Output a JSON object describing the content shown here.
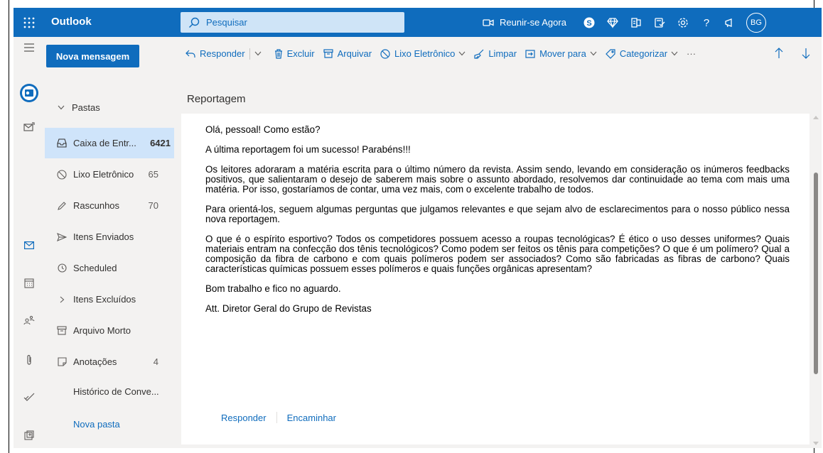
{
  "topbar": {
    "app_name": "Outlook",
    "search_placeholder": "Pesquisar",
    "meet_now": "Reunir-se Agora",
    "avatar_initials": "BG",
    "icons": [
      "waffle-icon",
      "search-icon",
      "video-icon",
      "skype-icon",
      "diamond-icon",
      "office-icon",
      "tasks-icon",
      "settings-icon",
      "help-icon",
      "megaphone-icon"
    ]
  },
  "rail": {
    "icons": [
      "outlook-app-icon",
      "mail-compose-icon",
      "mail-icon",
      "calendar-icon",
      "people-icon",
      "attach-icon",
      "todo-icon",
      "more-apps-icon"
    ]
  },
  "folders": {
    "new_message": "Nova mensagem",
    "section": "Pastas",
    "items": [
      {
        "label": "Caixa de Entr...",
        "count": "6421"
      },
      {
        "label": "Lixo Eletrônico",
        "count": "65"
      },
      {
        "label": "Rascunhos",
        "count": "70"
      },
      {
        "label": "Itens Enviados",
        "count": ""
      },
      {
        "label": "Scheduled",
        "count": ""
      },
      {
        "label": "Itens Excluídos",
        "count": ""
      },
      {
        "label": "Arquivo Morto",
        "count": ""
      },
      {
        "label": "Anotações",
        "count": "4"
      },
      {
        "label": "Histórico de Conve...",
        "count": ""
      },
      {
        "label": "Nova pasta",
        "count": ""
      }
    ]
  },
  "toolbar": {
    "reply": "Responder",
    "delete": "Excluir",
    "archive": "Arquivar",
    "junk": "Lixo Eletrônico",
    "sweep": "Limpar",
    "move": "Mover para",
    "categorize": "Categorizar",
    "more": "···"
  },
  "message": {
    "subject": "Reportagem",
    "paragraphs": [
      "Olá, pessoal! Como estão?",
      "A última reportagem foi um sucesso! Parabéns!!!",
      "Os leitores adoraram a matéria escrita para o último número da revista. Assim sendo, levando em consideração os inúmeros feedbacks positivos, que salientaram o desejo de saberem mais sobre o assunto abordado, resolvemos dar continuidade ao tema com mais uma matéria. Por isso, gostaríamos de contar, uma vez mais, com o excelente trabalho de todos.",
      "Para orientá-los, seguem algumas perguntas que julgamos relevantes e que sejam alvo de esclarecimentos para o nosso público nessa nova reportagem.",
      "O que é o espírito esportivo? Todos os competidores possuem acesso a roupas tecnológicas? É ético o uso desses uniformes? Quais materiais entram na confecção dos tênis tecnológicos? Como podem ser feitos os tênis para competições? O que é um polímero? Qual a composição da fibra de carbono e com quais polímeros podem ser associados? Como são fabricadas as fibras de carbono?  Quais características químicas possuem esses polímeros e quais funções orgânicas apresentam?",
      "Bom trabalho e fico no aguardo.",
      "Att. Diretor Geral do Grupo de Revistas"
    ],
    "reply_link": "Responder",
    "forward_link": "Encaminhar"
  },
  "colors": {
    "brand": "#0f6cbd",
    "search_bg": "#cfe4f7",
    "pane_bg": "#f3f2f1",
    "selected": "#cfe4fa"
  }
}
